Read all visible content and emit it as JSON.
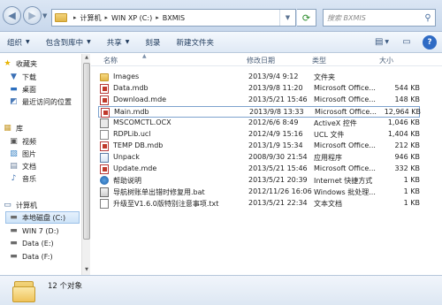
{
  "address_bar": {
    "breadcrumbs": [
      "计算机",
      "WIN XP (C:)",
      "BXMIS"
    ],
    "search_placeholder": "搜索 BXMIS"
  },
  "toolbar": {
    "organize": "组织",
    "include_in_library": "包含到库中",
    "share": "共享",
    "burn": "刻录",
    "new_folder": "新建文件夹"
  },
  "nav": {
    "favorites": "收藏夹",
    "downloads": "下载",
    "desktop": "桌面",
    "recent": "最近访问的位置",
    "libraries": "库",
    "videos": "视频",
    "pictures": "图片",
    "documents": "文档",
    "music": "音乐",
    "computer": "计算机",
    "drive_c": "本地磁盘 (C:)",
    "drive_d": "WIN 7 (D:)",
    "drive_e": "Data (E:)",
    "drive_f": "Data (F:)"
  },
  "columns": {
    "name": "名称",
    "modified": "修改日期",
    "type": "类型",
    "size": "大小"
  },
  "files": [
    {
      "name": "Images",
      "modified": "2013/9/4 9:12",
      "type": "文件夹",
      "size": "",
      "icon": "folder-icon"
    },
    {
      "name": "Data.mdb",
      "modified": "2013/9/8 11:20",
      "type": "Microsoft Office...",
      "size": "544 KB",
      "icon": "access-db-icon"
    },
    {
      "name": "Download.mde",
      "modified": "2013/5/21 15:46",
      "type": "Microsoft Office...",
      "size": "148 KB",
      "icon": "access-db-icon"
    },
    {
      "name": "Main.mdb",
      "modified": "2013/9/8 13:33",
      "type": "Microsoft Office...",
      "size": "12,964 KB",
      "icon": "access-db-icon"
    },
    {
      "name": "MSCOMCTL.OCX",
      "modified": "2012/6/6 8:49",
      "type": "ActiveX 控件",
      "size": "1,046 KB",
      "icon": "activex-icon"
    },
    {
      "name": "RDPLib.ucl",
      "modified": "2012/4/9 15:16",
      "type": "UCL 文件",
      "size": "1,404 KB",
      "icon": "document-icon"
    },
    {
      "name": "TEMP DB.mdb",
      "modified": "2013/1/9 15:34",
      "type": "Microsoft Office...",
      "size": "212 KB",
      "icon": "access-db-icon"
    },
    {
      "name": "Unpack",
      "modified": "2008/9/30 21:54",
      "type": "应用程序",
      "size": "946 KB",
      "icon": "application-icon"
    },
    {
      "name": "Update.mde",
      "modified": "2013/5/21 15:46",
      "type": "Microsoft Office...",
      "size": "332 KB",
      "icon": "access-db-icon"
    },
    {
      "name": "帮助说明",
      "modified": "2013/5/21 20:39",
      "type": "Internet 快捷方式",
      "size": "1 KB",
      "icon": "internet-shortcut-icon"
    },
    {
      "name": "导航树账单出错时修复用.bat",
      "modified": "2012/11/26 16:06",
      "type": "Windows 批处理...",
      "size": "1 KB",
      "icon": "batch-file-icon"
    },
    {
      "name": "升级至V1.6.0版特别注意事项.txt",
      "modified": "2013/5/21 22:34",
      "type": "文本文档",
      "size": "1 KB",
      "icon": "text-file-icon"
    }
  ],
  "status": {
    "item_count": "12 个对象"
  }
}
